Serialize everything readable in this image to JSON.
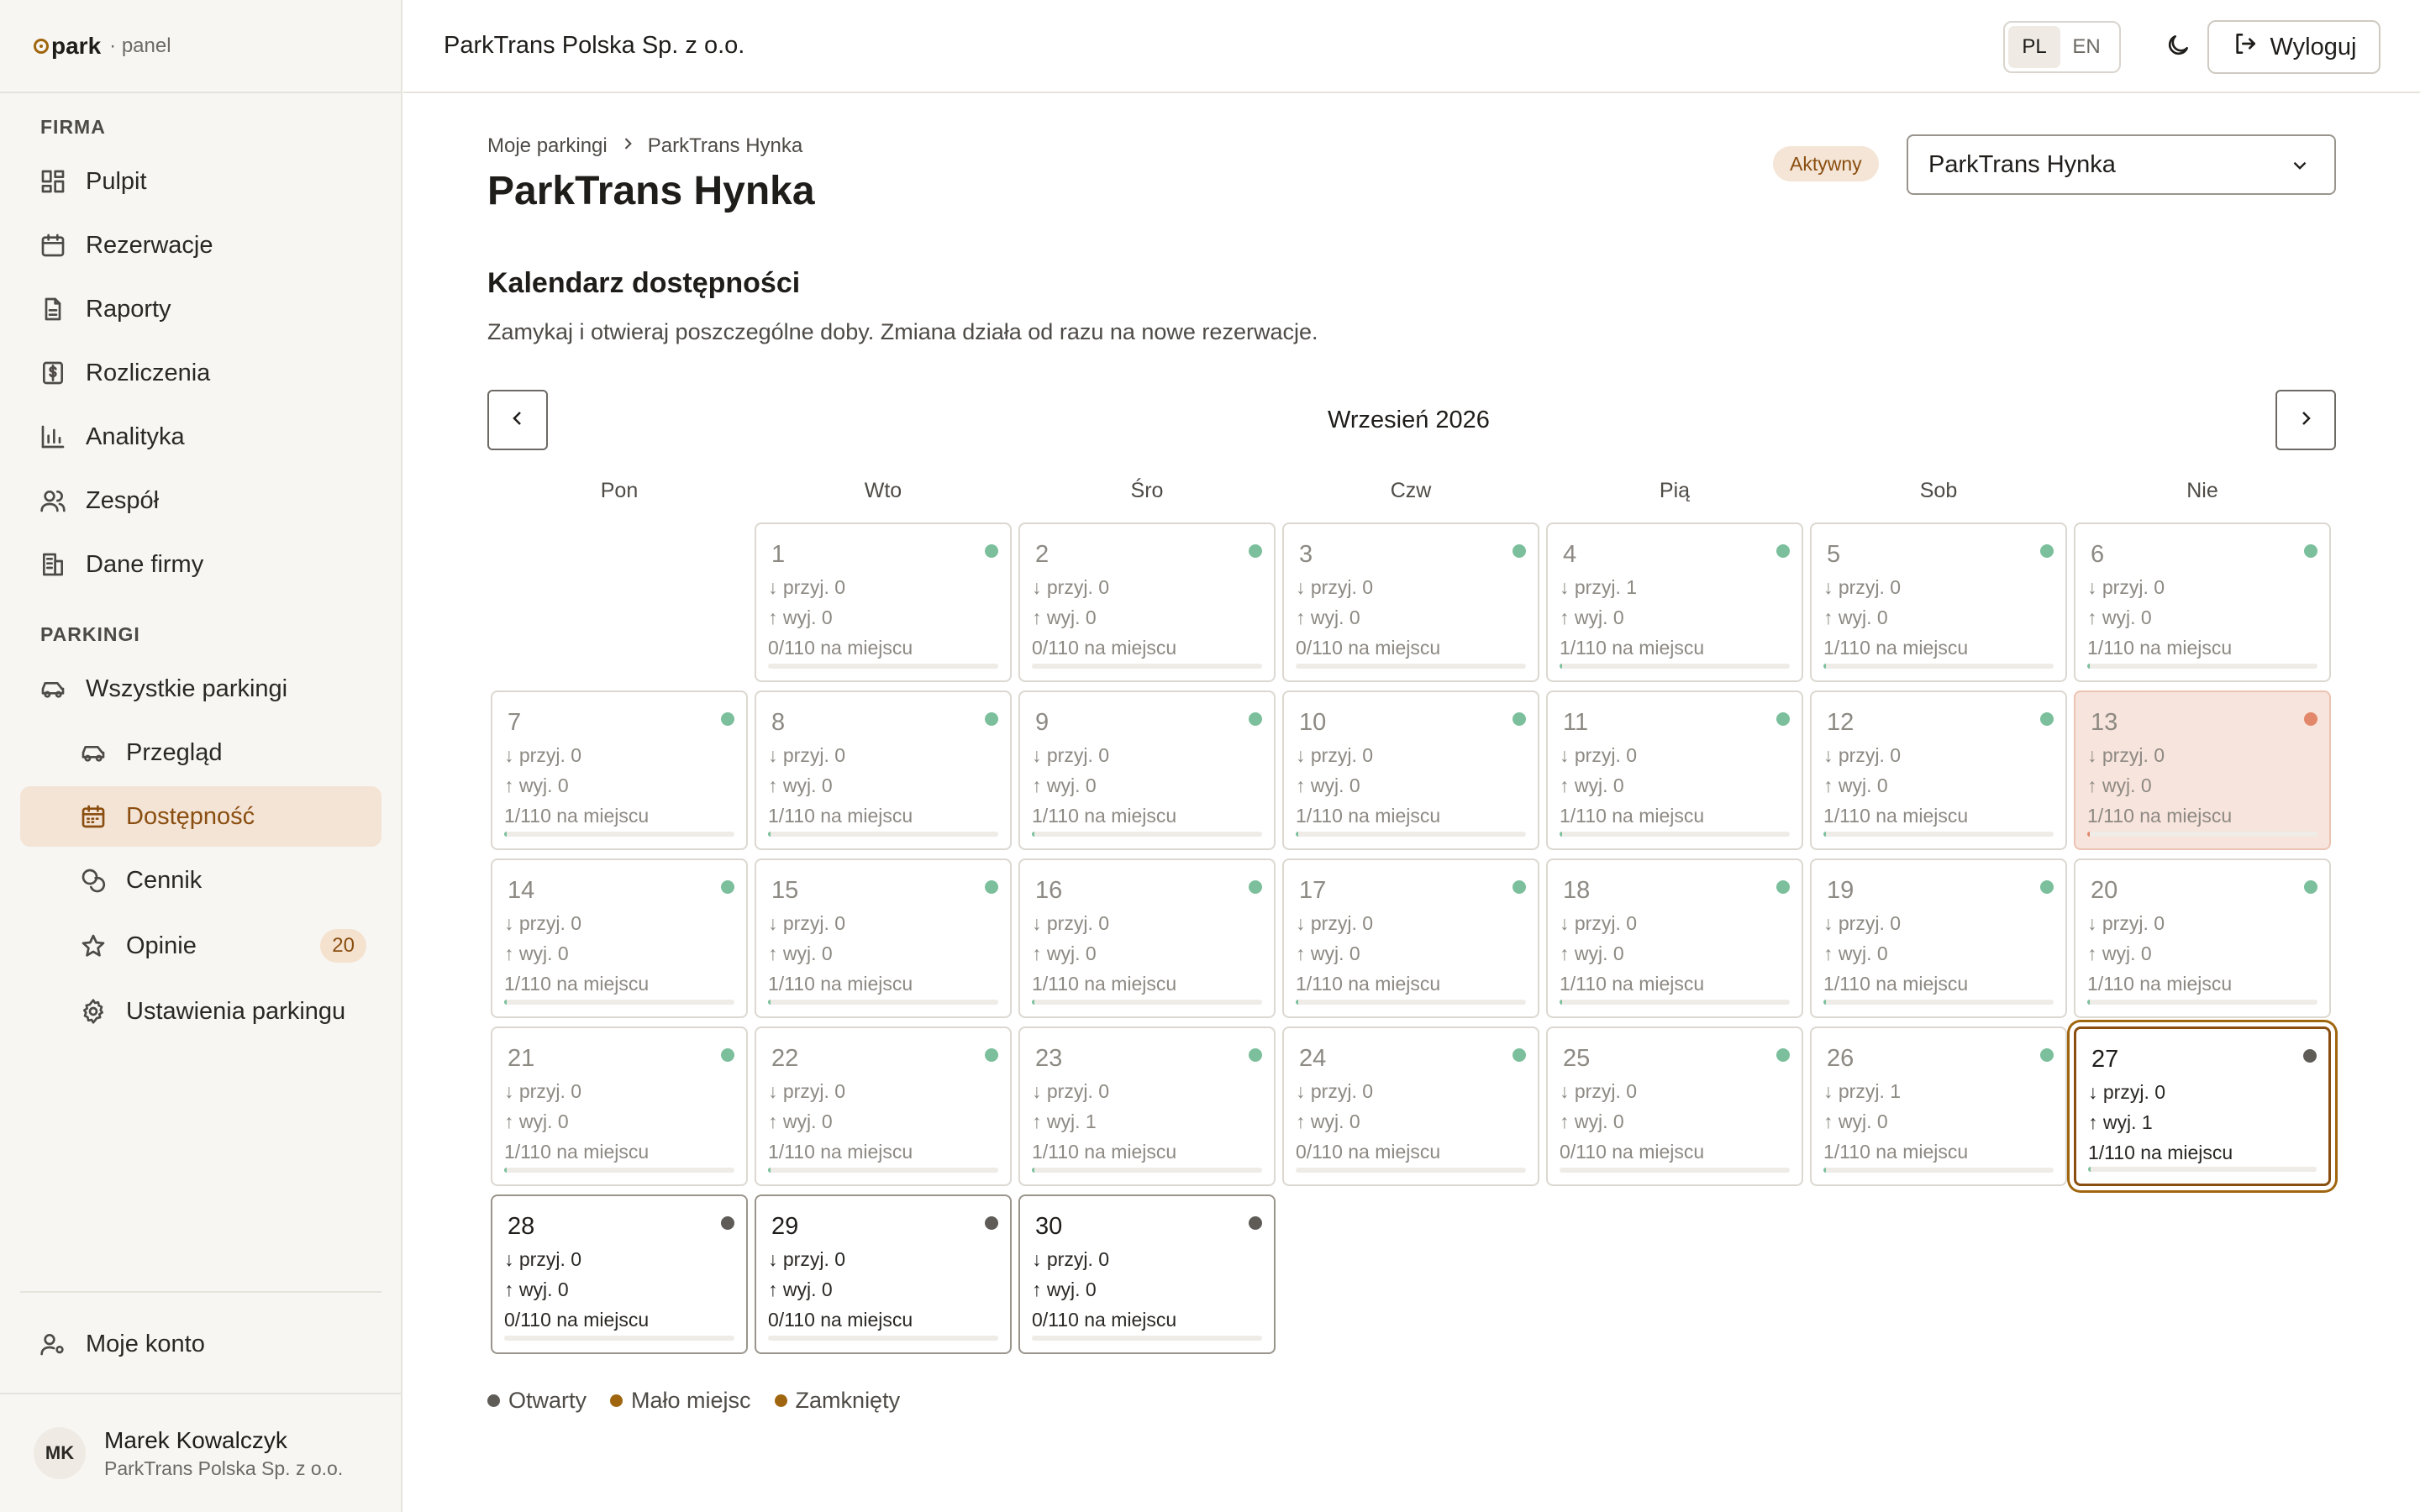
{
  "brand": {
    "logo": "park",
    "suffix": "· panel"
  },
  "header": {
    "company": "ParkTrans Polska Sp. z o.o.",
    "lang": [
      "PL",
      "EN"
    ],
    "lang_active": "PL",
    "logout": "Wyloguj"
  },
  "sidebar": {
    "firma_label": "FIRMA",
    "firma_items": [
      {
        "label": "Pulpit",
        "icon": "dashboard-icon"
      },
      {
        "label": "Rezerwacje",
        "icon": "calendar-icon"
      },
      {
        "label": "Raporty",
        "icon": "document-icon"
      },
      {
        "label": "Rozliczenia",
        "icon": "dollar-icon"
      },
      {
        "label": "Analityka",
        "icon": "chart-icon"
      },
      {
        "label": "Zespół",
        "icon": "users-icon"
      },
      {
        "label": "Dane firmy",
        "icon": "building-icon"
      }
    ],
    "parkingi_label": "PARKINGI",
    "all_parkings": "Wszystkie parkingi",
    "parking_items": [
      {
        "label": "Przegląd",
        "icon": "car-icon"
      },
      {
        "label": "Dostępność",
        "icon": "calendar-icon",
        "active": true
      },
      {
        "label": "Cennik",
        "icon": "coins-icon"
      },
      {
        "label": "Opinie",
        "icon": "star-icon",
        "badge": "20"
      },
      {
        "label": "Ustawienia parkingu",
        "icon": "gear-icon"
      }
    ],
    "account": "Moje konto",
    "user": {
      "initials": "MK",
      "name": "Marek Kowalczyk",
      "company": "ParkTrans Polska Sp. z o.o."
    }
  },
  "main": {
    "breadcrumb": [
      "Moje parkingi",
      "ParkTrans Hynka"
    ],
    "title": "ParkTrans Hynka",
    "status": "Aktywny",
    "select_value": "ParkTrans Hynka",
    "calendar_title": "Kalendarz dostępności",
    "calendar_desc": "Zamykaj i otwieraj poszczególne doby. Zmiana działa od razu na nowe rezerwacje.",
    "month": "Wrzesień 2026",
    "weekdays": [
      "Pon",
      "Wto",
      "Śro",
      "Czw",
      "Pią",
      "Sob",
      "Nie"
    ],
    "capacity": 110,
    "days": [
      {
        "d": 1,
        "in": 0,
        "out": 0,
        "occ": 0,
        "state": "past"
      },
      {
        "d": 2,
        "in": 0,
        "out": 0,
        "occ": 0,
        "state": "past"
      },
      {
        "d": 3,
        "in": 0,
        "out": 0,
        "occ": 0,
        "state": "past"
      },
      {
        "d": 4,
        "in": 1,
        "out": 0,
        "occ": 1,
        "state": "past"
      },
      {
        "d": 5,
        "in": 0,
        "out": 0,
        "occ": 1,
        "state": "past"
      },
      {
        "d": 6,
        "in": 0,
        "out": 0,
        "occ": 1,
        "state": "past"
      },
      {
        "d": 7,
        "in": 0,
        "out": 0,
        "occ": 1,
        "state": "past"
      },
      {
        "d": 8,
        "in": 0,
        "out": 0,
        "occ": 1,
        "state": "past"
      },
      {
        "d": 9,
        "in": 0,
        "out": 0,
        "occ": 1,
        "state": "past"
      },
      {
        "d": 10,
        "in": 0,
        "out": 0,
        "occ": 1,
        "state": "past"
      },
      {
        "d": 11,
        "in": 0,
        "out": 0,
        "occ": 1,
        "state": "past"
      },
      {
        "d": 12,
        "in": 0,
        "out": 0,
        "occ": 1,
        "state": "past"
      },
      {
        "d": 13,
        "in": 0,
        "out": 0,
        "occ": 1,
        "state": "closed"
      },
      {
        "d": 14,
        "in": 0,
        "out": 0,
        "occ": 1,
        "state": "past"
      },
      {
        "d": 15,
        "in": 0,
        "out": 0,
        "occ": 1,
        "state": "past"
      },
      {
        "d": 16,
        "in": 0,
        "out": 0,
        "occ": 1,
        "state": "past"
      },
      {
        "d": 17,
        "in": 0,
        "out": 0,
        "occ": 1,
        "state": "past"
      },
      {
        "d": 18,
        "in": 0,
        "out": 0,
        "occ": 1,
        "state": "past"
      },
      {
        "d": 19,
        "in": 0,
        "out": 0,
        "occ": 1,
        "state": "past"
      },
      {
        "d": 20,
        "in": 0,
        "out": 0,
        "occ": 1,
        "state": "past"
      },
      {
        "d": 21,
        "in": 0,
        "out": 0,
        "occ": 1,
        "state": "past"
      },
      {
        "d": 22,
        "in": 0,
        "out": 0,
        "occ": 1,
        "state": "past"
      },
      {
        "d": 23,
        "in": 0,
        "out": 1,
        "occ": 1,
        "state": "past"
      },
      {
        "d": 24,
        "in": 0,
        "out": 0,
        "occ": 0,
        "state": "past"
      },
      {
        "d": 25,
        "in": 0,
        "out": 0,
        "occ": 0,
        "state": "past"
      },
      {
        "d": 26,
        "in": 1,
        "out": 0,
        "occ": 1,
        "state": "past"
      },
      {
        "d": 27,
        "in": 0,
        "out": 1,
        "occ": 1,
        "state": "today"
      },
      {
        "d": 28,
        "in": 0,
        "out": 0,
        "occ": 0,
        "state": "upcoming"
      },
      {
        "d": 29,
        "in": 0,
        "out": 0,
        "occ": 0,
        "state": "upcoming"
      },
      {
        "d": 30,
        "in": 0,
        "out": 0,
        "occ": 0,
        "state": "upcoming"
      }
    ],
    "labels": {
      "in": "przyj.",
      "out": "wyj.",
      "on_site": "na miejscu"
    },
    "legend": [
      {
        "label": "Otwarty",
        "color": "#5f5c57"
      },
      {
        "label": "Mało miejsc",
        "color": "#a0660f"
      },
      {
        "label": "Zamknięty",
        "color": "#a0660f"
      }
    ]
  }
}
